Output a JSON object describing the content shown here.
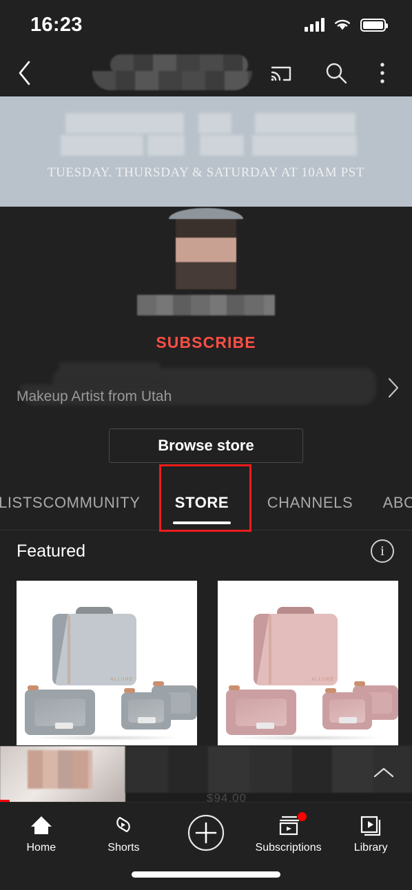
{
  "status_bar": {
    "time": "16:23",
    "signal_icon": "cellular-signal-icon",
    "wifi_icon": "wifi-icon",
    "battery_icon": "battery-full-icon"
  },
  "nav_bar": {
    "back_icon": "chevron-left-icon",
    "channel_name_redacted": "",
    "cast_icon": "cast-icon",
    "search_icon": "search-icon",
    "more_icon": "overflow-menu-icon"
  },
  "banner": {
    "schedule_text": "TUESDAY, THURSDAY & SATURDAY AT 10AM PST",
    "background_color": "#b9c2ca"
  },
  "channel": {
    "avatar_alt": "channel-avatar-blurred",
    "name_redacted": "",
    "subscribe_label": "SUBSCRIBE",
    "subscribe_color": "#ff4e45",
    "description": "Makeup Artist from Utah",
    "expand_icon": "chevron-right-icon",
    "browse_store_label": "Browse store"
  },
  "tabs": [
    {
      "label": "LISTS",
      "active": false,
      "truncated": true
    },
    {
      "label": "COMMUNITY",
      "active": false,
      "truncated": false
    },
    {
      "label": "STORE",
      "active": true,
      "truncated": false
    },
    {
      "label": "CHANNELS",
      "active": false,
      "truncated": false
    },
    {
      "label": "ABOUT",
      "active": false,
      "truncated": true
    }
  ],
  "annotation": {
    "highlight_color": "#ef1c1c",
    "target": "STORE"
  },
  "store": {
    "section_title": "Featured",
    "info_icon": "info-circle-icon",
    "products": [
      {
        "name": "gray-travel-case-set",
        "case_color": "#b6bcc2",
        "case_shade": "#9aa1a8",
        "window_color": "#a9aeb3",
        "background": "#ffffff"
      },
      {
        "name": "pink-travel-case-set",
        "case_color": "#dfb5b5",
        "case_shade": "#c79a9c",
        "window_color": "#cfa3a6",
        "background": "#ffffff"
      }
    ]
  },
  "mini_player": {
    "thumbnail_alt": "video-thumbnail-blurred",
    "title_redacted": "",
    "price_partial": "$94.00",
    "expand_icon": "chevron-up-icon",
    "progress_color": "#ff0000"
  },
  "bottom_nav": [
    {
      "label": "Home",
      "icon": "home-icon",
      "badge": false
    },
    {
      "label": "Shorts",
      "icon": "shorts-icon",
      "badge": false
    },
    {
      "label": "",
      "icon": "create-plus-icon",
      "badge": false
    },
    {
      "label": "Subscriptions",
      "icon": "subscriptions-icon",
      "badge": true
    },
    {
      "label": "Library",
      "icon": "library-icon",
      "badge": false
    }
  ]
}
